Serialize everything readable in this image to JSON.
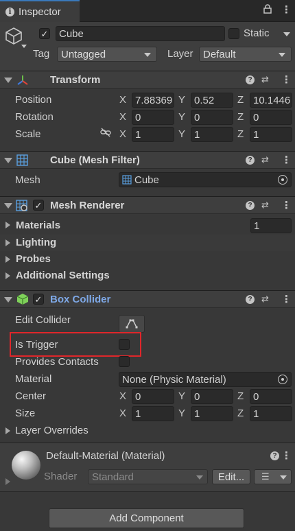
{
  "tab": {
    "title": "Inspector"
  },
  "object": {
    "name": "Cube",
    "static_label": "Static",
    "tag_label": "Tag",
    "tag_value": "Untagged",
    "layer_label": "Layer",
    "layer_value": "Default"
  },
  "transform": {
    "title": "Transform",
    "position_label": "Position",
    "rotation_label": "Rotation",
    "scale_label": "Scale",
    "x": "X",
    "y": "Y",
    "z": "Z",
    "position": [
      "7.88369",
      "0.52",
      "10.1446"
    ],
    "rotation": [
      "0",
      "0",
      "0"
    ],
    "scale": [
      "1",
      "1",
      "1"
    ]
  },
  "mesh_filter": {
    "title": "Cube (Mesh Filter)",
    "mesh_label": "Mesh",
    "mesh_value": "Cube"
  },
  "mesh_renderer": {
    "title": "Mesh Renderer",
    "materials_label": "Materials",
    "materials_count": "1",
    "lighting_label": "Lighting",
    "probes_label": "Probes",
    "additional_label": "Additional Settings"
  },
  "box_collider": {
    "title": "Box Collider",
    "edit_collider_label": "Edit Collider",
    "is_trigger_label": "Is Trigger",
    "provides_contacts_label": "Provides Contacts",
    "material_label": "Material",
    "material_value": "None (Physic Material)",
    "center_label": "Center",
    "center": [
      "0",
      "0",
      "0"
    ],
    "size_label": "Size",
    "size": [
      "1",
      "1",
      "1"
    ],
    "layer_overrides_label": "Layer Overrides"
  },
  "material": {
    "title": "Default-Material (Material)",
    "shader_label": "Shader",
    "shader_value": "Standard",
    "edit_label": "Edit..."
  },
  "footer": {
    "add_component_label": "Add Component"
  }
}
